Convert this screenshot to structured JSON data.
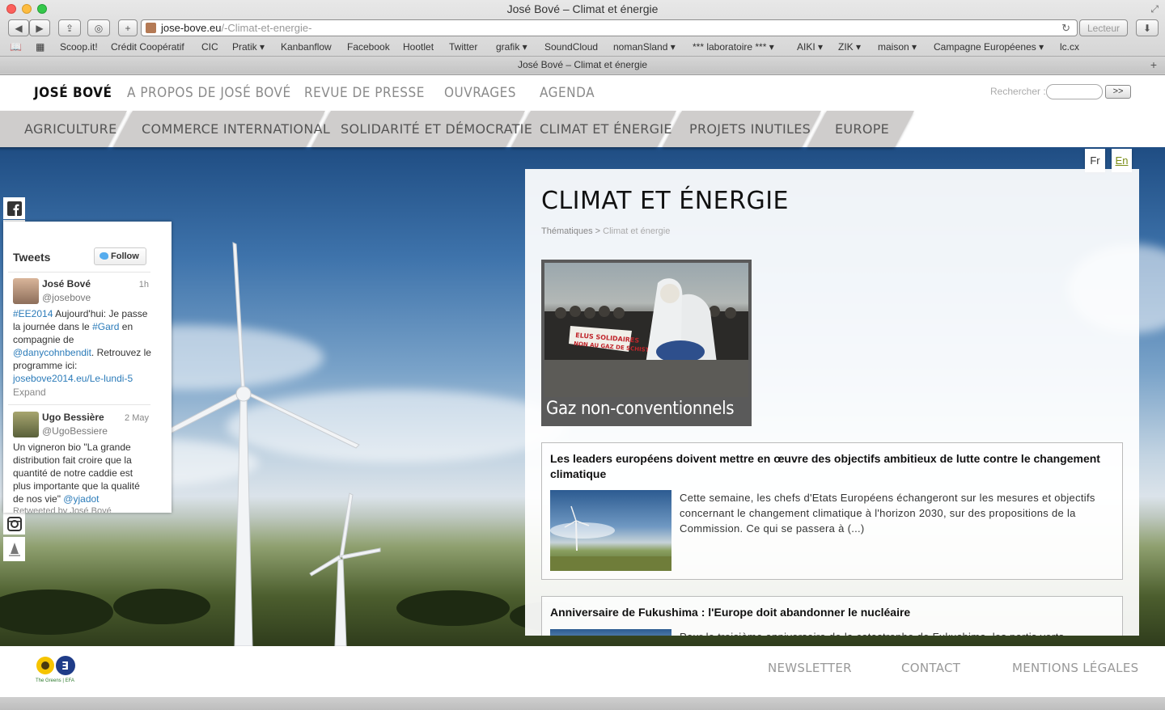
{
  "browser": {
    "window_title": "José Bové – Climat et énergie",
    "url_host": "jose-bove.eu",
    "url_path": "/-Climat-et-energie-",
    "reader_label": "Lecteur",
    "tab_title": "José Bové – Climat et énergie",
    "bookmarks": [
      "Scoop.it!",
      "Crédit Coopératif",
      "CIC",
      "Pratik ▾",
      "Kanbanflow",
      "Facebook",
      "Hootlet",
      "Twitter",
      "grafik ▾",
      "SoundCloud",
      "nomanSland ▾",
      "*** laboratoire *** ▾",
      "AIKI ▾",
      "ZIK ▾",
      "maison ▾",
      "Campagne Européenes ▾",
      "lc.cx"
    ]
  },
  "site": {
    "brand": "JOSÉ BOVÉ",
    "nav": [
      "A PROPOS DE JOSÉ BOVÉ",
      "REVUE DE PRESSE",
      "OUVRAGES",
      "AGENDA"
    ],
    "search_label": "Rechercher :",
    "search_button": ">>",
    "themes": [
      "AGRICULTURE",
      "COMMERCE INTERNATIONAL",
      "SOLIDARITÉ ET DÉMOCRATIE",
      "CLIMAT ET ÉNERGIE",
      "PROJETS INUTILES",
      "EUROPE"
    ],
    "lang_fr": "Fr",
    "lang_en": "En"
  },
  "main": {
    "title": "CLIMAT ET ÉNERGIE",
    "breadcrumb_root": "Thématiques",
    "breadcrumb_sep": ">",
    "breadcrumb_current": "Climat et énergie",
    "feature_label": "Gaz non-conventionnels",
    "feature_banner": "ELUS SOLIDAIRES NON AU GAZ DE SCHISTE",
    "articles": [
      {
        "title": "Les leaders européens doivent mettre en œuvre des objectifs ambitieux de lutte contre le changement climatique",
        "text": "Cette semaine, les chefs d'Etats Européens échangeront sur les mesures et objectifs concernant le changement climatique à l'horizon 2030, sur des propositions de la Commission. Ce qui se passera à (...)"
      },
      {
        "title": "Anniversaire de Fukushima : l'Europe doit abandonner le nucléaire",
        "text": "Pour le troisième anniversaire de la catastrophe de Fukushima, les partis verts"
      }
    ]
  },
  "twitter": {
    "header": "Tweets",
    "follow": "Follow",
    "tweets": [
      {
        "name": "José Bové",
        "handle": "@josebove",
        "time": "1h",
        "body_html": "<span class='lnk'>#EE2014</span> Aujourd'hui: Je passe la journée dans le <span class='lnk'>#Gard</span> en compagnie de <span class='lnk'>@danycohnbendit</span>. Retrouvez le programme ici: <span class='lnk'>josebove2014.eu/Le-lundi-5</span>",
        "expand": "Expand"
      },
      {
        "name": "Ugo Bessière",
        "handle": "@UgoBessiere",
        "time": "2 May",
        "body_html": "Un vigneron bio \"La grande distribution fait croire que la quantité de notre caddie est plus importante que la qualité de nos vie\" <span class='lnk'>@yjadot</span>",
        "retweet": "Retweeted by José Bové"
      }
    ]
  },
  "footer": {
    "links": [
      "NEWSLETTER",
      "CONTACT",
      "MENTIONS LÉGALES"
    ],
    "logo_text": "The Greens | EFA"
  },
  "colors": {
    "accent": "#7a8c16",
    "nav_grey": "#cfcdcc",
    "twitter_link": "#2b7bb9"
  }
}
